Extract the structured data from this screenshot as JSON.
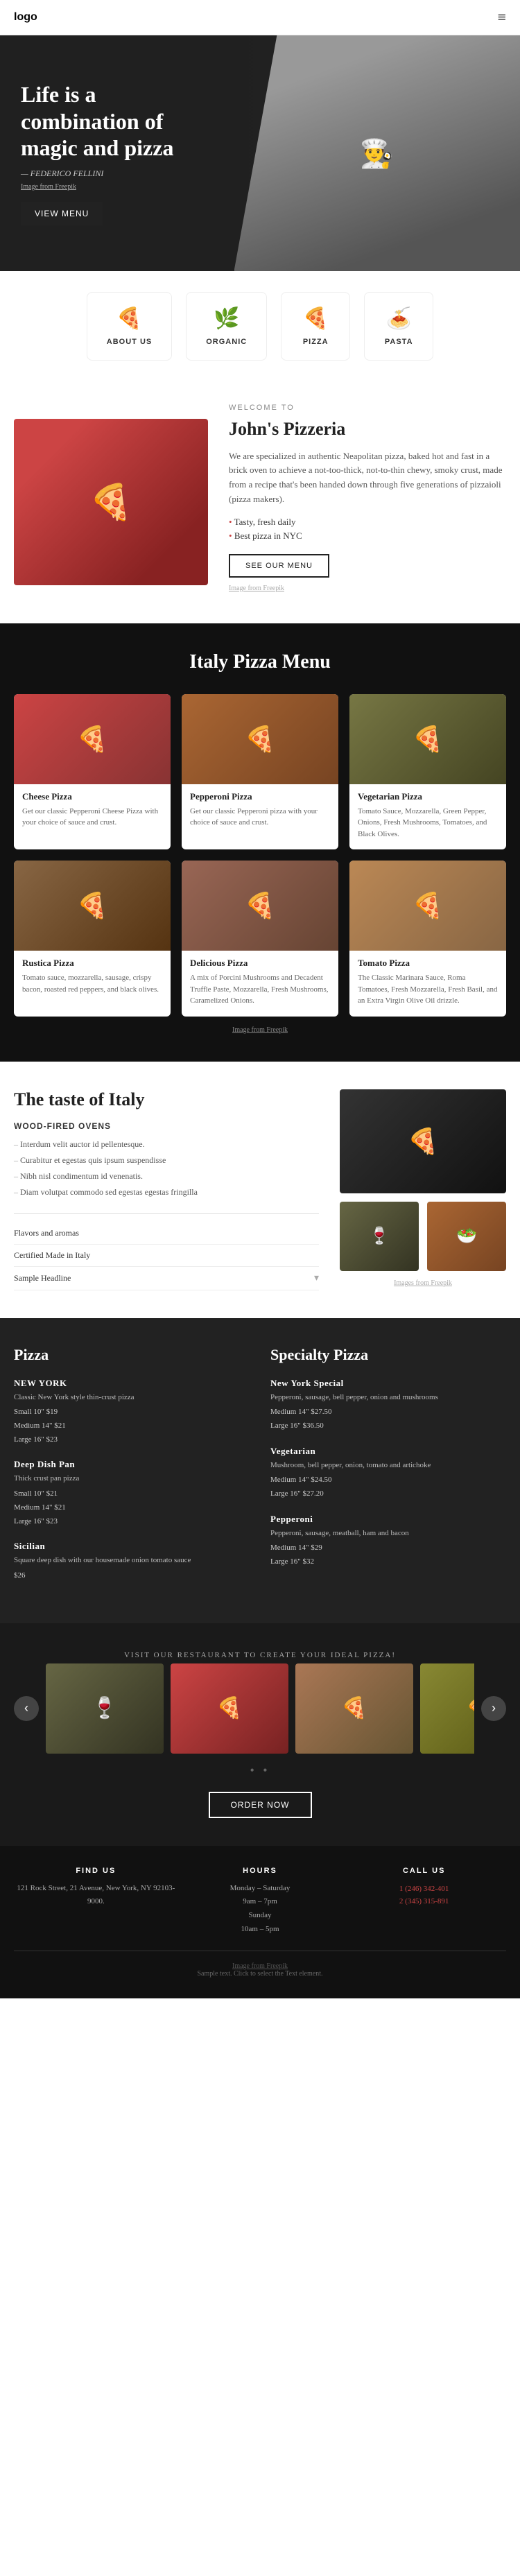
{
  "nav": {
    "logo": "logo",
    "hamburger_icon": "≡"
  },
  "hero": {
    "headline": "Life is a combination of magic and pizza",
    "author": "— FEDERICO FELLINI",
    "img_credit": "Image from Freepik",
    "button_label": "VIEW MENU"
  },
  "icons_row": [
    {
      "id": "about-us",
      "symbol": "🍕",
      "label": "ABOUT US"
    },
    {
      "id": "organic",
      "symbol": "🌿",
      "label": "ORGANIC"
    },
    {
      "id": "pizza",
      "symbol": "🍕",
      "label": "PIZZA"
    },
    {
      "id": "pasta",
      "symbol": "🍝",
      "label": "PASTA"
    }
  ],
  "welcome": {
    "pre_title": "WELCOME TO",
    "title": "John's Pizzeria",
    "body": "We are specialized in authentic Neapolitan pizza, baked hot and fast in a brick oven to achieve a not-too-thick, not-to-thin chewy, smoky crust, made from a recipe that's been handed down through five generations of pizzaioli (pizza makers).",
    "bullet_1": "Tasty, fresh daily",
    "bullet_2": "Best pizza in NYC",
    "button_label": "SEE OUR MENU",
    "img_credit": "Image from Freepik"
  },
  "pizza_menu": {
    "title": "Italy Pizza Menu",
    "img_credit": "Image from Freepik",
    "items": [
      {
        "name": "Cheese Pizza",
        "description": "Get our classic Pepperoni Cheese Pizza with your choice of sauce and crust."
      },
      {
        "name": "Pepperoni Pizza",
        "description": "Get our classic Pepperoni pizza with your choice of sauce and crust."
      },
      {
        "name": "Vegetarian Pizza",
        "description": "Tomato Sauce, Mozzarella, Green Pepper, Onions, Fresh Mushrooms, Tomatoes, and Black Olives."
      },
      {
        "name": "Rustica Pizza",
        "description": "Tomato sauce, mozzarella, sausage, crispy bacon, roasted red peppers, and black olives."
      },
      {
        "name": "Delicious Pizza",
        "description": "A mix of Porcini Mushrooms and Decadent Truffle Paste, Mozzarella, Fresh Mushrooms, Caramelized Onions."
      },
      {
        "name": "Tomato Pizza",
        "description": "The Classic Marinara Sauce, Roma Tomatoes, Fresh Mozzarella, Fresh Basil, and an Extra Virgin Olive Oil drizzle."
      }
    ]
  },
  "taste": {
    "title": "The taste of Italy",
    "section_label": "Wood-fired ovens",
    "bullets": [
      "Interdum velit auctor id pellentesque.",
      "Curabitur et egestas quis ipsum suspendisse",
      "Nibh nisl condimentum id venenatis.",
      "Diam volutpat commodo sed egestas egestas fringilla"
    ],
    "flavor_label": "Flavors and aromas",
    "certified_label": "Certified Made in Italy",
    "sample_label": "Sample Headline",
    "img_credit": "Images from Freepik"
  },
  "price_menu": {
    "col1_title": "Pizza",
    "col2_title": "Specialty Pizza",
    "items_col1": [
      {
        "name": "NEW YORK",
        "description": "Classic New York style thin-crust pizza",
        "prices": [
          "Small 10\" $19",
          "Medium 14\" $21",
          "Large 16\" $23"
        ]
      },
      {
        "name": "Deep Dish Pan",
        "description": "Thick crust pan pizza",
        "prices": [
          "Small 10\" $21",
          "Medium 14\" $21",
          "Large 16\" $23"
        ]
      },
      {
        "name": "Sicilian",
        "description": "Square deep dish with our housemade onion tomato sauce",
        "prices": [
          "$26"
        ]
      }
    ],
    "items_col2": [
      {
        "name": "New York Special",
        "description": "Pepperoni, sausage, bell pepper, onion and mushrooms",
        "prices": [
          "Medium 14\" $27.50",
          "Large 16\" $36.50"
        ]
      },
      {
        "name": "Vegetarian",
        "description": "Mushroom, bell pepper, onion, tomato and artichoke",
        "prices": [
          "Medium 14\" $24.50",
          "Large 16\" $27.20"
        ]
      },
      {
        "name": "Pepperoni",
        "description": "Pepperoni, sausage, meatball, ham and bacon",
        "prices": [
          "Medium 14\" $29",
          "Large 16\" $32"
        ]
      }
    ]
  },
  "carousel": {
    "subtitle": "visit our restaurant to create your ideal pizza!",
    "title": "Visit our restaurant to create your ideal pizza!",
    "prev_icon": "‹",
    "next_icon": "›",
    "dots": "• •",
    "button_label": "ORDER NOW"
  },
  "footer": {
    "find_us": {
      "title": "FIND US",
      "address": "121 Rock Street, 21 Avenue, New York, NY 92103-9000."
    },
    "hours": {
      "title": "HOURS",
      "weekday": "Monday – Saturday",
      "weekday_hours": "9am – 7pm",
      "sunday": "Sunday",
      "sunday_hours": "10am – 5pm"
    },
    "call_us": {
      "title": "CALL US",
      "phone1": "1 (246) 342-401",
      "phone2": "2 (345) 315-891"
    },
    "img_credit": "Image from Freepik",
    "copyright": "Sample text. Click to select the Text element."
  }
}
